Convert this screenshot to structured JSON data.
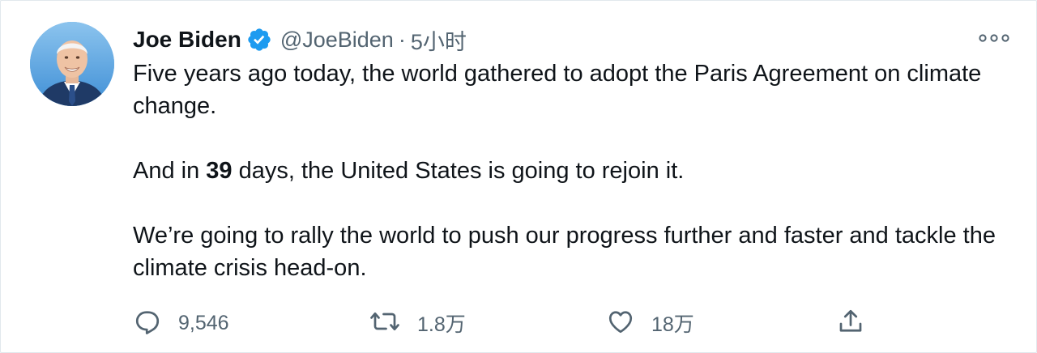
{
  "tweet": {
    "author_name": "Joe Biden",
    "handle": "@JoeBiden",
    "separator": "·",
    "time": "5小时",
    "paragraphs": {
      "p1": "Five years ago today, the world gathered to adopt the Paris Agreement on climate change.",
      "p2_before": "And in ",
      "p2_bold": "39",
      "p2_after": " days, the United States is going to rejoin it.",
      "p3": "We’re going to rally the world to push our progress further and faster and tackle the climate crisis head-on."
    }
  },
  "actions": {
    "reply": {
      "icon": "reply-icon",
      "count": "9,546"
    },
    "retweet": {
      "icon": "retweet-icon",
      "count": "1.8万"
    },
    "like": {
      "icon": "heart-icon",
      "count": "18万"
    },
    "share": {
      "icon": "share-icon"
    }
  },
  "icons": {
    "verified": "verified-badge-icon",
    "more": "more-options-icon"
  },
  "colors": {
    "verified_blue": "#1d9bf0",
    "text": "#0f1419",
    "secondary": "#536471"
  }
}
